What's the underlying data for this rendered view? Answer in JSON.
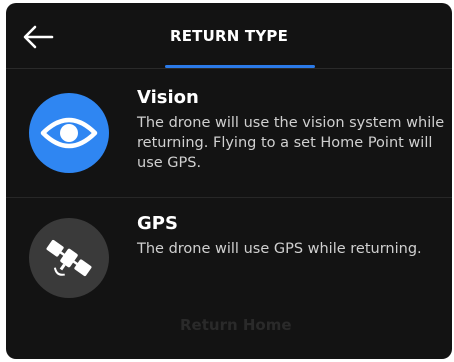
{
  "header": {
    "back_icon": "arrow-left-icon",
    "title": "RETURN TYPE",
    "accent": "#2b7ae8"
  },
  "options": [
    {
      "title": "Vision",
      "description": "The drone will use the vision system while returning. Flying to a set Home Point will use GPS.",
      "icon": "eye-icon",
      "color": "#2f86f2",
      "selected": true
    },
    {
      "title": "GPS",
      "description": "The drone will use GPS while returning.",
      "icon": "satellite-icon",
      "color": "#3a3a3a",
      "selected": false
    }
  ],
  "footer": {
    "button_label": "Return Home"
  }
}
